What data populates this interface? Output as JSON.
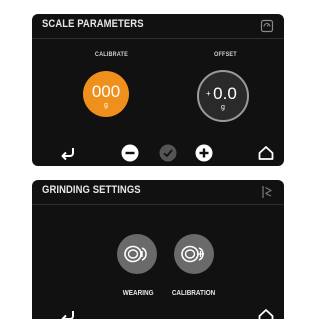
{
  "scale_panel": {
    "title": "SCALE PARAMETERS",
    "header_icon": "scale-icon",
    "calibrate_label": "CALIBRATE",
    "calibrate_value": "000",
    "calibrate_unit": "g",
    "offset_label": "OFFSET",
    "offset_sign": "+",
    "offset_value": "0.0",
    "offset_unit": "g",
    "toolbar": [
      "back-icon",
      "minus-icon",
      "check-icon",
      "plus-icon",
      "home-icon"
    ],
    "colors": {
      "calibrate": "#f0901c",
      "offset_ring": "#9a9a9a"
    }
  },
  "grinding_panel": {
    "title": "GRINDING SETTINGS",
    "header_icon": "grinder-icon",
    "buttons": [
      {
        "label": "WEARING",
        "icon": "burr-wear-icon"
      },
      {
        "label": "CALIBRATION",
        "icon": "burr-calibration-icon"
      }
    ],
    "toolbar": [
      "back-icon",
      "home-icon"
    ]
  }
}
